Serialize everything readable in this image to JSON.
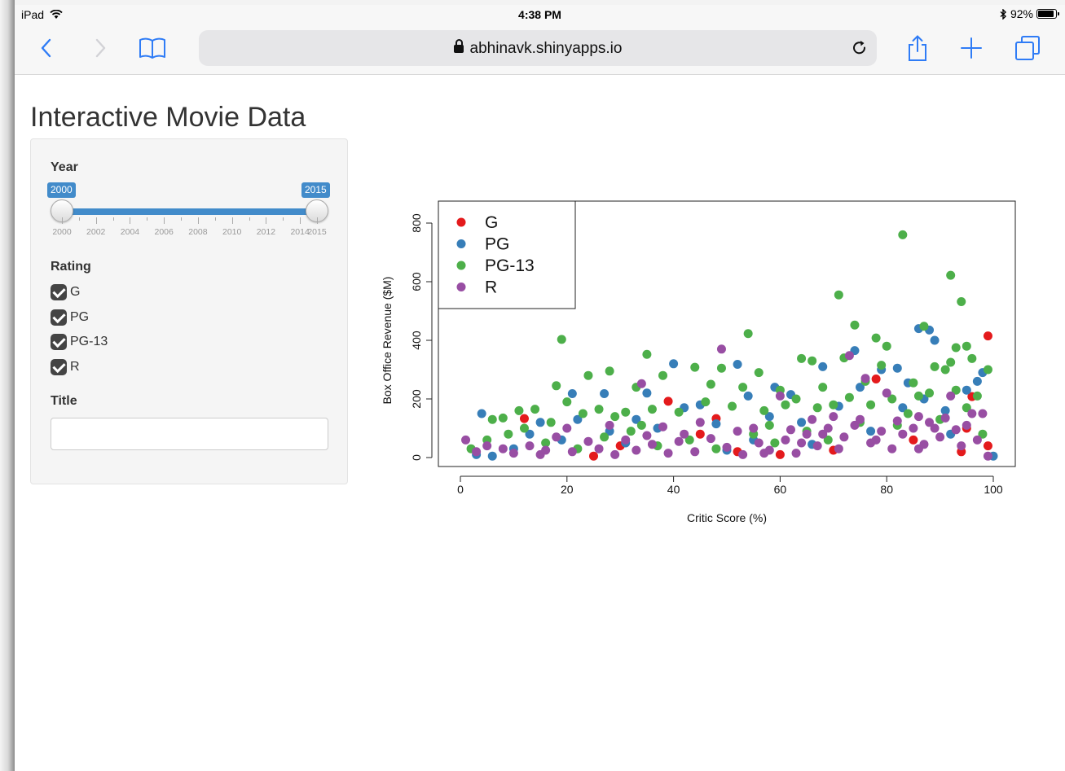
{
  "status_bar": {
    "device": "iPad",
    "time": "4:38 PM",
    "battery": "92%",
    "battery_level": 0.92
  },
  "browser": {
    "url": "abhinavk.shinyapps.io"
  },
  "page": {
    "title": "Interactive Movie Data"
  },
  "sidebar": {
    "year": {
      "label": "Year",
      "min": 2000,
      "max": 2015,
      "from": "2000",
      "to": "2015",
      "tick_labels": [
        "2000",
        "2002",
        "2004",
        "2006",
        "2008",
        "2010",
        "2012",
        "2014",
        "2015"
      ]
    },
    "rating": {
      "label": "Rating",
      "options": [
        {
          "label": "G",
          "checked": true
        },
        {
          "label": "PG",
          "checked": true
        },
        {
          "label": "PG-13",
          "checked": true
        },
        {
          "label": "R",
          "checked": true
        }
      ]
    },
    "title_filter": {
      "label": "Title",
      "value": "",
      "placeholder": ""
    }
  },
  "chart_data": {
    "type": "scatter",
    "xlabel": "Critic Score (%)",
    "ylabel": "Box Office Revenue ($M)",
    "xlim": [
      0,
      100
    ],
    "ylim": [
      0,
      800
    ],
    "x_ticks": [
      "0",
      "20",
      "40",
      "60",
      "80",
      "100"
    ],
    "y_ticks": [
      "0",
      "200",
      "400",
      "600",
      "800"
    ],
    "legend_position": "top-left",
    "series": [
      {
        "name": "G",
        "color": "#e41a1c",
        "points": [
          [
            99,
            415
          ],
          [
            96,
            208
          ],
          [
            78,
            268
          ],
          [
            39,
            192
          ],
          [
            48,
            133
          ],
          [
            12,
            133
          ],
          [
            94,
            20
          ],
          [
            99,
            40
          ],
          [
            95,
            100
          ],
          [
            70,
            25
          ],
          [
            25,
            5
          ],
          [
            45,
            80
          ],
          [
            60,
            10
          ],
          [
            85,
            60
          ],
          [
            30,
            40
          ],
          [
            52,
            20
          ]
        ]
      },
      {
        "name": "PG",
        "color": "#377eb8",
        "points": [
          [
            86,
            440
          ],
          [
            88,
            435
          ],
          [
            89,
            400
          ],
          [
            74,
            365
          ],
          [
            98,
            290
          ],
          [
            97,
            260
          ],
          [
            40,
            320
          ],
          [
            52,
            318
          ],
          [
            21,
            218
          ],
          [
            27,
            218
          ],
          [
            35,
            220
          ],
          [
            54,
            210
          ],
          [
            59,
            240
          ],
          [
            62,
            215
          ],
          [
            68,
            310
          ],
          [
            79,
            300
          ],
          [
            82,
            305
          ],
          [
            84,
            255
          ],
          [
            87,
            200
          ],
          [
            4,
            150
          ],
          [
            15,
            120
          ],
          [
            33,
            130
          ],
          [
            42,
            170
          ],
          [
            48,
            115
          ],
          [
            45,
            180
          ],
          [
            71,
            175
          ],
          [
            75,
            240
          ],
          [
            91,
            160
          ],
          [
            58,
            140
          ],
          [
            10,
            30
          ],
          [
            19,
            60
          ],
          [
            22,
            130
          ],
          [
            28,
            90
          ],
          [
            37,
            100
          ],
          [
            55,
            60
          ],
          [
            64,
            120
          ],
          [
            77,
            90
          ],
          [
            92,
            80
          ],
          [
            100,
            5
          ],
          [
            3,
            10
          ],
          [
            6,
            5
          ],
          [
            50,
            25
          ],
          [
            66,
            45
          ],
          [
            95,
            230
          ],
          [
            83,
            170
          ],
          [
            13,
            80
          ],
          [
            31,
            50
          ]
        ]
      },
      {
        "name": "PG-13",
        "color": "#4daf4a",
        "points": [
          [
            83,
            760
          ],
          [
            92,
            622
          ],
          [
            71,
            555
          ],
          [
            94,
            532
          ],
          [
            74,
            452
          ],
          [
            87,
            448
          ],
          [
            95,
            380
          ],
          [
            93,
            375
          ],
          [
            54,
            423
          ],
          [
            19,
            403
          ],
          [
            35,
            352
          ],
          [
            78,
            408
          ],
          [
            80,
            380
          ],
          [
            92,
            325
          ],
          [
            96,
            338
          ],
          [
            18,
            245
          ],
          [
            24,
            280
          ],
          [
            28,
            295
          ],
          [
            44,
            308
          ],
          [
            49,
            305
          ],
          [
            56,
            290
          ],
          [
            64,
            338
          ],
          [
            66,
            330
          ],
          [
            72,
            340
          ],
          [
            79,
            315
          ],
          [
            89,
            310
          ],
          [
            91,
            300
          ],
          [
            33,
            240
          ],
          [
            38,
            280
          ],
          [
            47,
            250
          ],
          [
            53,
            240
          ],
          [
            60,
            230
          ],
          [
            68,
            240
          ],
          [
            76,
            260
          ],
          [
            85,
            255
          ],
          [
            99,
            300
          ],
          [
            6,
            130
          ],
          [
            8,
            135
          ],
          [
            11,
            160
          ],
          [
            14,
            165
          ],
          [
            17,
            120
          ],
          [
            20,
            190
          ],
          [
            23,
            150
          ],
          [
            26,
            165
          ],
          [
            29,
            140
          ],
          [
            31,
            155
          ],
          [
            36,
            165
          ],
          [
            41,
            155
          ],
          [
            46,
            190
          ],
          [
            51,
            175
          ],
          [
            57,
            160
          ],
          [
            61,
            180
          ],
          [
            63,
            200
          ],
          [
            67,
            170
          ],
          [
            70,
            180
          ],
          [
            73,
            205
          ],
          [
            77,
            180
          ],
          [
            81,
            200
          ],
          [
            86,
            210
          ],
          [
            88,
            220
          ],
          [
            93,
            230
          ],
          [
            97,
            210
          ],
          [
            2,
            30
          ],
          [
            5,
            60
          ],
          [
            9,
            80
          ],
          [
            16,
            50
          ],
          [
            22,
            30
          ],
          [
            27,
            70
          ],
          [
            32,
            90
          ],
          [
            37,
            40
          ],
          [
            43,
            60
          ],
          [
            48,
            30
          ],
          [
            55,
            80
          ],
          [
            59,
            50
          ],
          [
            65,
            90
          ],
          [
            69,
            60
          ],
          [
            75,
            120
          ],
          [
            82,
            110
          ],
          [
            90,
            130
          ],
          [
            98,
            80
          ],
          [
            12,
            100
          ],
          [
            34,
            110
          ],
          [
            58,
            110
          ],
          [
            84,
            150
          ],
          [
            95,
            170
          ]
        ]
      },
      {
        "name": "R",
        "color": "#984ea3",
        "points": [
          [
            49,
            370
          ],
          [
            73,
            348
          ],
          [
            34,
            252
          ],
          [
            76,
            270
          ],
          [
            60,
            210
          ],
          [
            80,
            220
          ],
          [
            92,
            210
          ],
          [
            96,
            150
          ],
          [
            98,
            150
          ],
          [
            66,
            130
          ],
          [
            70,
            140
          ],
          [
            86,
            140
          ],
          [
            91,
            135
          ],
          [
            1,
            60
          ],
          [
            3,
            20
          ],
          [
            5,
            40
          ],
          [
            8,
            30
          ],
          [
            10,
            15
          ],
          [
            13,
            40
          ],
          [
            16,
            25
          ],
          [
            18,
            70
          ],
          [
            21,
            20
          ],
          [
            24,
            55
          ],
          [
            26,
            30
          ],
          [
            29,
            10
          ],
          [
            31,
            60
          ],
          [
            33,
            25
          ],
          [
            36,
            45
          ],
          [
            39,
            15
          ],
          [
            41,
            55
          ],
          [
            44,
            20
          ],
          [
            47,
            65
          ],
          [
            50,
            35
          ],
          [
            53,
            10
          ],
          [
            56,
            50
          ],
          [
            58,
            25
          ],
          [
            61,
            60
          ],
          [
            63,
            15
          ],
          [
            65,
            80
          ],
          [
            67,
            40
          ],
          [
            69,
            100
          ],
          [
            71,
            30
          ],
          [
            72,
            70
          ],
          [
            74,
            110
          ],
          [
            77,
            50
          ],
          [
            79,
            90
          ],
          [
            81,
            30
          ],
          [
            83,
            80
          ],
          [
            85,
            100
          ],
          [
            87,
            45
          ],
          [
            88,
            120
          ],
          [
            90,
            70
          ],
          [
            93,
            95
          ],
          [
            94,
            40
          ],
          [
            97,
            60
          ],
          [
            99,
            5
          ],
          [
            20,
            100
          ],
          [
            28,
            110
          ],
          [
            38,
            105
          ],
          [
            45,
            120
          ],
          [
            55,
            100
          ],
          [
            62,
            95
          ],
          [
            68,
            80
          ],
          [
            75,
            130
          ],
          [
            82,
            125
          ],
          [
            89,
            100
          ],
          [
            95,
            110
          ],
          [
            42,
            80
          ],
          [
            52,
            90
          ],
          [
            64,
            50
          ],
          [
            78,
            60
          ],
          [
            86,
            30
          ],
          [
            15,
            10
          ],
          [
            35,
            75
          ],
          [
            57,
            15
          ]
        ]
      }
    ]
  }
}
